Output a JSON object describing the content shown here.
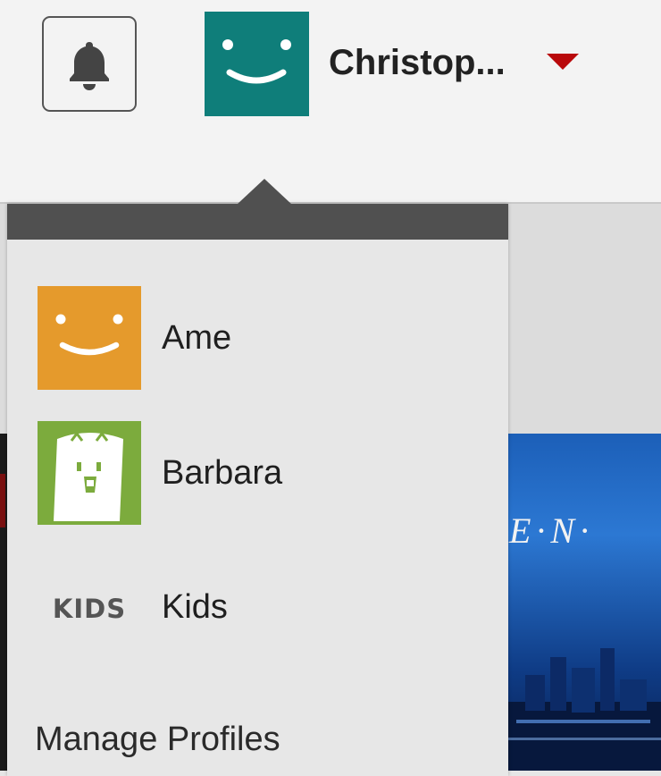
{
  "header": {
    "current_profile_name": "Christop...",
    "accent_color": "#b9090b"
  },
  "dropdown": {
    "profiles": [
      {
        "name": "Ame",
        "avatar": "orange-smiley-avatar",
        "color": "#e59a2c"
      },
      {
        "name": "Barbara",
        "avatar": "green-character-avatar",
        "color": "#7cab3d"
      },
      {
        "name": "Kids",
        "avatar": "kids-avatar",
        "avatar_text": "KIDS"
      }
    ],
    "manage_label": "Manage Profiles"
  },
  "current_avatar_color": "#0f7e7a",
  "poster_text": "E·N·",
  "icons": {
    "bell": "bell-icon",
    "caret": "caret-down-icon"
  }
}
